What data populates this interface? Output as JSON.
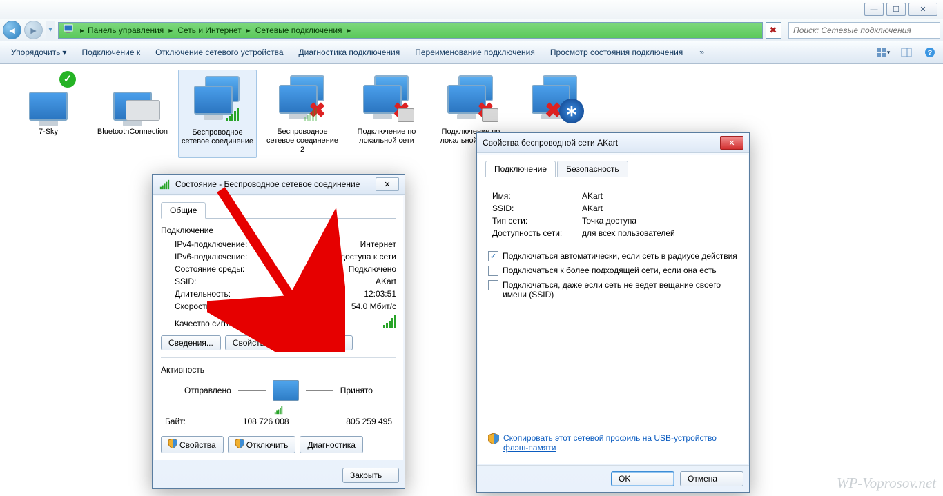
{
  "window": {
    "min_glyph": "—",
    "max_glyph": "☐",
    "close_glyph": "✕"
  },
  "breadcrumb": {
    "seg1": "Панель управления",
    "seg2": "Сеть и Интернет",
    "seg3": "Сетевые подключения"
  },
  "search": {
    "placeholder": "Поиск: Сетевые подключения"
  },
  "toolbar": {
    "organize": "Упорядочить",
    "connect_to": "Подключение к",
    "disable": "Отключение сетевого устройства",
    "diagnose": "Диагностика подключения",
    "rename": "Переименование подключения",
    "view_status": "Просмотр состояния подключения",
    "overflow": "»"
  },
  "connections": [
    {
      "name": "7-Sky"
    },
    {
      "name": "BluetoothConnection"
    },
    {
      "name": "Беспроводное сетевое соединение"
    },
    {
      "name": "Беспроводное сетевое соединение 2"
    },
    {
      "name": "Подключение по локальной сети"
    },
    {
      "name": "Подключение по локальной сети 2"
    },
    {
      "name": ""
    }
  ],
  "status_dlg": {
    "title": "Состояние - Беспроводное сетевое соединение",
    "tab_general": "Общие",
    "grp_connection": "Подключение",
    "ipv4_label": "IPv4-подключение:",
    "ipv4_value": "Интернет",
    "ipv6_label": "IPv6-подключение:",
    "ipv6_value": "Без доступа к сети",
    "media_label": "Состояние среды:",
    "media_value": "Подключено",
    "ssid_label": "SSID:",
    "ssid_value": "AKart",
    "duration_label": "Длительность:",
    "duration_value": "12:03:51",
    "speed_label": "Скорость:",
    "speed_value": "54.0 Мбит/с",
    "signal_label": "Качество сигнала:",
    "btn_details": "Сведения...",
    "btn_wprops": "Свойства беспроводной сети",
    "grp_activity": "Активность",
    "sent_label": "Отправлено",
    "recv_label": "Принято",
    "bytes_label": "Байт:",
    "bytes_sent": "108 726 008",
    "bytes_recv": "805 259 495",
    "btn_props": "Свойства",
    "btn_disable": "Отключить",
    "btn_diag": "Диагностика",
    "btn_close": "Закрыть"
  },
  "props_dlg": {
    "title": "Свойства беспроводной сети AKart",
    "tab_conn": "Подключение",
    "tab_sec": "Безопасность",
    "name_label": "Имя:",
    "name_value": "AKart",
    "ssid_label": "SSID:",
    "ssid_value": "AKart",
    "nettype_label": "Тип сети:",
    "nettype_value": "Точка доступа",
    "avail_label": "Доступность сети:",
    "avail_value": "для всех пользователей",
    "chk1": "Подключаться автоматически, если сеть в радиусе действия",
    "chk2": "Подключаться к более подходящей сети, если она есть",
    "chk3": "Подключаться, даже если сеть не ведет вещание своего имени (SSID)",
    "copy_link": "Скопировать этот сетевой профиль на USB-устройство флэш-памяти",
    "btn_ok": "OK",
    "btn_cancel": "Отмена"
  },
  "watermark": "WP-Voprosov.net"
}
